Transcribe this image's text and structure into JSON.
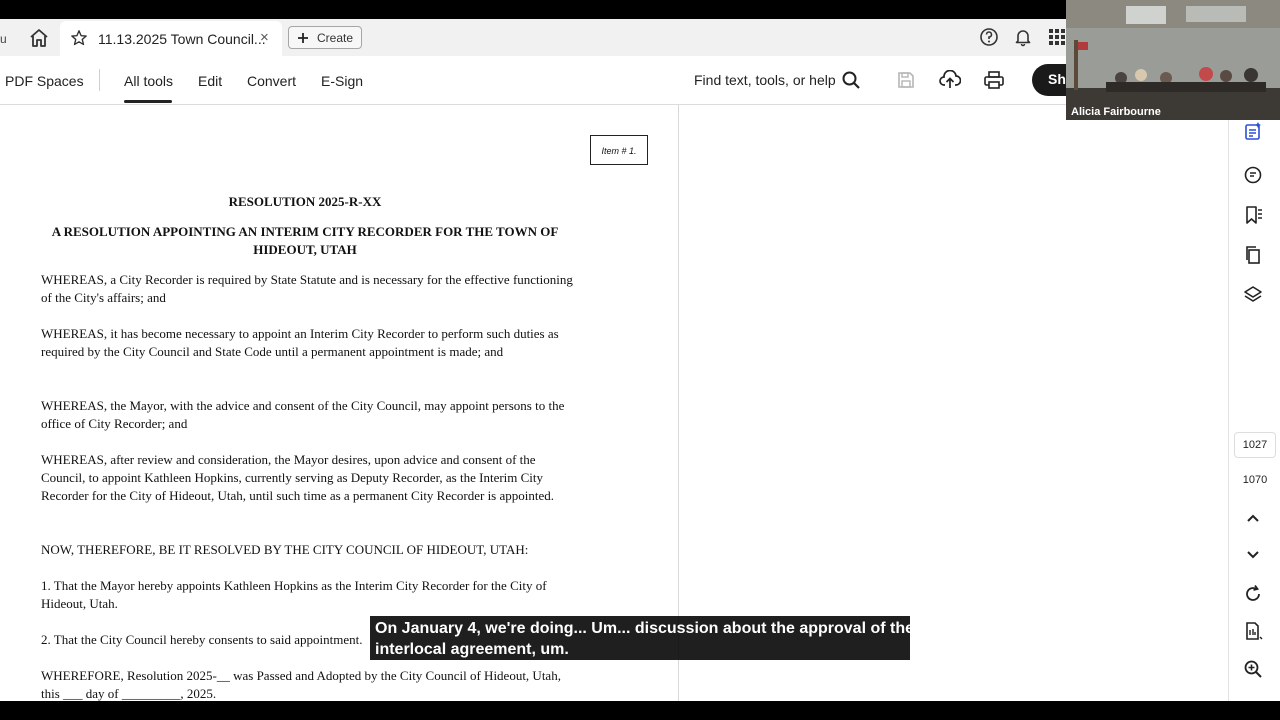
{
  "tabbar": {
    "left_edge_char": "u",
    "active_tab_title": "11.13.2025 Town Council...",
    "close_glyph": "×",
    "create_label": "Create"
  },
  "toolbar": {
    "spaces_label": "PDF Spaces",
    "tabs": [
      "All tools",
      "Edit",
      "Convert",
      "E-Sign"
    ],
    "active_tab": "All tools",
    "find_label": "Find text, tools, or help",
    "share_label": "Sh"
  },
  "document": {
    "item_label": "Item # 1.",
    "title": "RESOLUTION 2025-R-XX",
    "subtitle_line1": "A RESOLUTION APPOINTING AN INTERIM CITY RECORDER FOR THE TOWN OF",
    "subtitle_line2": "HIDEOUT, UTAH",
    "para1": "WHEREAS, a City Recorder is required by State Statute and is necessary for the effective functioning of the City's affairs; and",
    "para2": "WHEREAS, it has become necessary to appoint an Interim City Recorder to perform such duties as required by the City Council and State Code until a permanent appointment is made; and",
    "para3": "WHEREAS, the Mayor, with the advice and consent of the City Council, may appoint persons to the office of City Recorder; and",
    "para4": "WHEREAS, after review and consideration, the Mayor desires, upon advice and consent of the Council, to appoint Kathleen Hopkins, currently serving as Deputy Recorder, as the Interim City Recorder for the City of Hideout, Utah, until such time as a permanent City Recorder is appointed.",
    "para5": "NOW, THEREFORE, BE IT RESOLVED BY THE CITY COUNCIL OF HIDEOUT, UTAH:",
    "para6": "1. That the Mayor hereby appoints Kathleen Hopkins as the Interim City Recorder for the City of Hideout, Utah.",
    "para7": "2. That the City Council hereby consents to said appointment.",
    "para8": "WHEREFORE, Resolution 2025-__ was Passed and Adopted by the City Council of Hideout, Utah, this ___ day of _________, 2025."
  },
  "rail": {
    "current_page": "1027",
    "total_pages": "1070"
  },
  "video": {
    "participant_name": "Alicia Fairbourne"
  },
  "caption": {
    "line1": "On January 4, we're doing... Um... discussion about the approval of the",
    "line2": "interlocal agreement, um."
  },
  "colors": {
    "tab_bar_bg": "#f1f1f1",
    "share_button_bg": "#1a1a1a",
    "caption_bg": "#000000"
  }
}
